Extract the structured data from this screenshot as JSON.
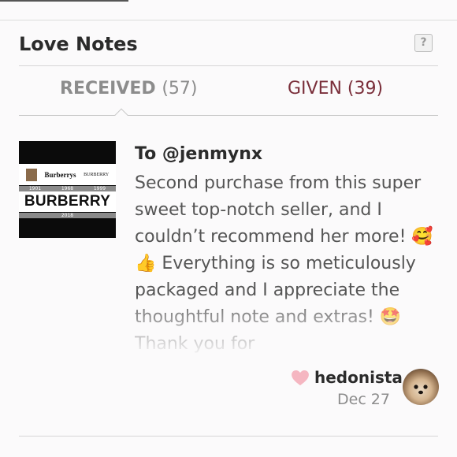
{
  "header": {
    "title": "Love Notes",
    "help_label": "?"
  },
  "tabs": [
    {
      "label": "RECEIVED",
      "count": "(57)"
    },
    {
      "label": "GIVEN (39)"
    }
  ],
  "note": {
    "thumbnail": {
      "logo_left": "Burberrys",
      "logo_right": "BURBERRY",
      "years": [
        "1901",
        "1968",
        "1999"
      ],
      "brand": "BURBERRY",
      "year_bottom": "2018"
    },
    "to": "To @jenmynx",
    "body": "Second purchase from this super sweet top-notch seller, and I couldn’t recommend her more! 🥰👍 Everything is so meticulously packaged and I appreciate the thoughtful note and extras! 🤩 Thank you for",
    "author": "hedonista",
    "date": "Dec 27"
  },
  "colors": {
    "given_tab": "#7a2e3a",
    "received_tab": "#8c8c8c",
    "heart": "#f5b6c1"
  }
}
